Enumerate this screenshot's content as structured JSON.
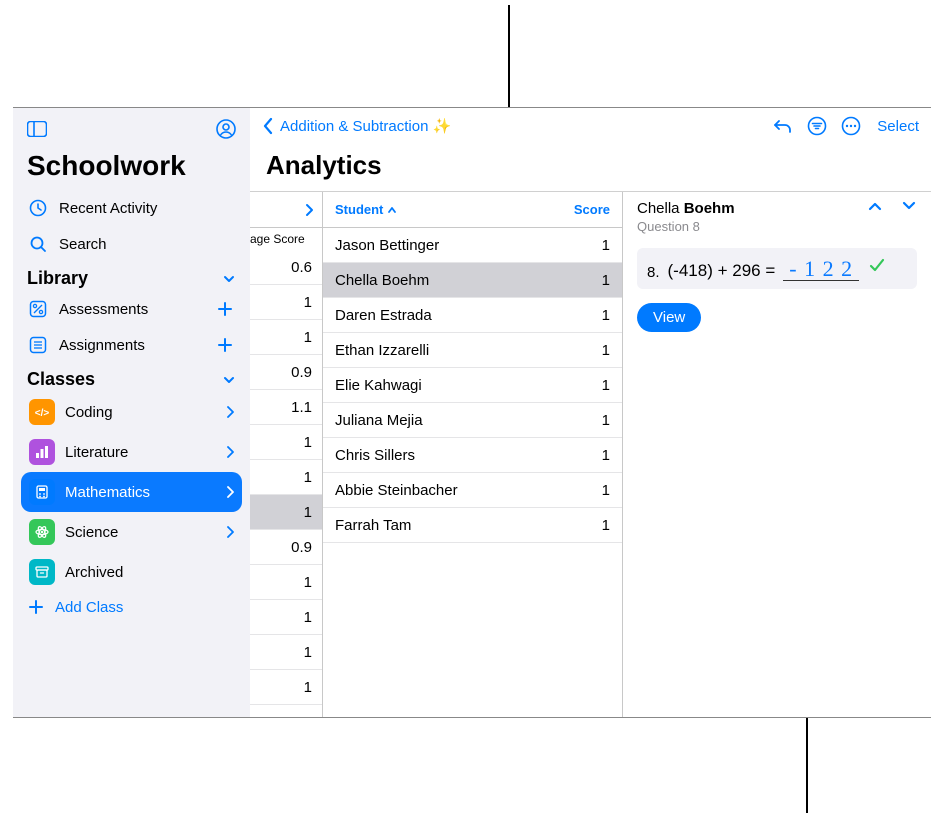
{
  "sidebar": {
    "title": "Schoolwork",
    "recent": "Recent Activity",
    "search": "Search",
    "library_hdr": "Library",
    "assessments": "Assessments",
    "assignments": "Assignments",
    "classes_hdr": "Classes",
    "classes": [
      {
        "label": "Coding",
        "color": "#ff9500",
        "icon": "fn"
      },
      {
        "label": "Literature",
        "color": "#af52de",
        "icon": "bars"
      },
      {
        "label": "Mathematics",
        "color": "#007aff",
        "icon": "calc",
        "selected": true
      },
      {
        "label": "Science",
        "color": "#34c759",
        "icon": "atom"
      },
      {
        "label": "Archived",
        "color": "#00b8c7",
        "icon": "archive",
        "no_chev": true
      }
    ],
    "add_class": "Add Class"
  },
  "header": {
    "back_label": "Addition & Subtraction ✨",
    "title": "Analytics",
    "select": "Select"
  },
  "colA": {
    "sub": "age Score",
    "rows": [
      {
        "v": "0.6"
      },
      {
        "v": "1"
      },
      {
        "v": "1"
      },
      {
        "v": "0.9"
      },
      {
        "v": "1.1"
      },
      {
        "v": "1"
      },
      {
        "v": "1"
      },
      {
        "v": "1",
        "selected": true
      },
      {
        "v": "0.9"
      },
      {
        "v": "1"
      },
      {
        "v": "1"
      },
      {
        "v": "1"
      },
      {
        "v": "1"
      }
    ]
  },
  "colB": {
    "hdr_student": "Student",
    "hdr_score": "Score",
    "rows": [
      {
        "name": "Jason Bettinger",
        "score": "1"
      },
      {
        "name": "Chella Boehm",
        "score": "1",
        "selected": true
      },
      {
        "name": "Daren Estrada",
        "score": "1"
      },
      {
        "name": "Ethan Izzarelli",
        "score": "1"
      },
      {
        "name": "Elie Kahwagi",
        "score": "1"
      },
      {
        "name": "Juliana Mejia",
        "score": "1"
      },
      {
        "name": "Chris Sillers",
        "score": "1"
      },
      {
        "name": "Abbie Steinbacher",
        "score": "1"
      },
      {
        "name": "Farrah Tam",
        "score": "1"
      }
    ]
  },
  "detail": {
    "first": "Chella ",
    "last": "Boehm",
    "question": "Question 8",
    "qnum": "8.",
    "expr": "(-418) + 296 =",
    "hand": "- 1 2 2",
    "view": "View"
  }
}
